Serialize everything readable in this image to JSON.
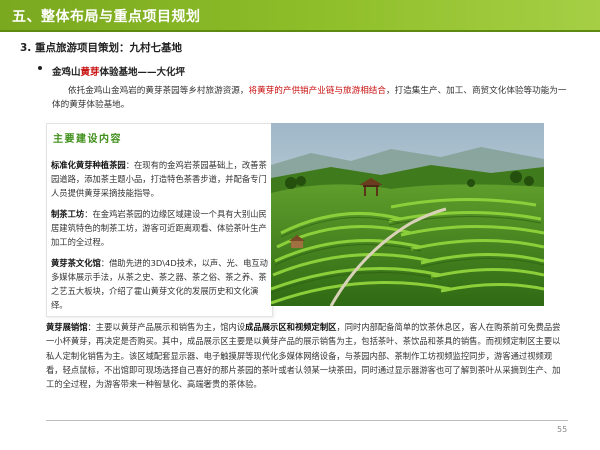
{
  "header": {
    "title": "五、整体布局与重点项目规划"
  },
  "section": {
    "heading": "3. 重点旅游项目策划：九村七基地"
  },
  "bullet": {
    "prefix": "金鸡山",
    "highlight": "黄芽",
    "suffix": "体验基地——大化坪"
  },
  "intro": {
    "part1": "依托金鸡山金鸡岩的黄芽茶园等乡村旅游资源，",
    "highlight": "将黄芽的产供销产业链与旅游相结合",
    "part2": "，打造集生产、加工、商贸文化体验等功能为一体的黄芽体验基地。"
  },
  "box": {
    "title": "主要建设内容",
    "items": [
      {
        "name": "标准化黄芽种植茶园",
        "text": "：在现有的金鸡岩茶园基础上，改善茶园道路，添加茶主题小品，打造特色茶香步道，并配备专门人员提供黄芽采摘技能指导。"
      },
      {
        "name": "制茶工坊",
        "text": "：在金鸡岩茶园的边缘区域建设一个具有大别山民居建筑特色的制茶工坊，游客可近距离观看、体验茶叶生产加工的全过程。"
      },
      {
        "name": "黄芽茶文化馆",
        "text": "：借助先进的3D\\4D技术，以声、光、电互动多媒体展示手法，从茶之史、茶之器、茶之俗、茶之养、茶之艺五大板块，介绍了霍山黄芽文化的发展历史和文化演绎。"
      }
    ]
  },
  "bottom": {
    "name": "黄芽展销馆",
    "t1": "：主要以黄芽产品展示和销售为主，馆内设",
    "bold1": "成品展示区和视频定制区",
    "t2": "，同时内部配备简单的饮茶休息区，客人在购茶前可免费品尝一小杯黄芽，再决定是否购买。其中，成品展示区主要是以黄芽产品的展示销售为主，包括茶叶、茶饮品和茶具的销售。而视频定制区主要以私人定制化销售为主。该区域配套显示器、电子触摸屏等现代化多媒体网络设备，与茶园内部、茶制作工坊视频监控同步，游客通过视频观看，轻点鼠标，不出馆即可现场选择自己喜好的那片茶园的茶叶或者认领某一块茶田，同时通过显示器游客也可了解到茶叶从采摘到生产、加工的全过程，为游客带来一种智慧化、高端奢贵的茶体验。"
  },
  "footer": {
    "page": "55"
  },
  "colors": {
    "header": "#8fbf2a",
    "highlight": "#c81010",
    "box_title": "#3f8f1a"
  },
  "icons": {
    "bullet": "bullet-dot"
  }
}
